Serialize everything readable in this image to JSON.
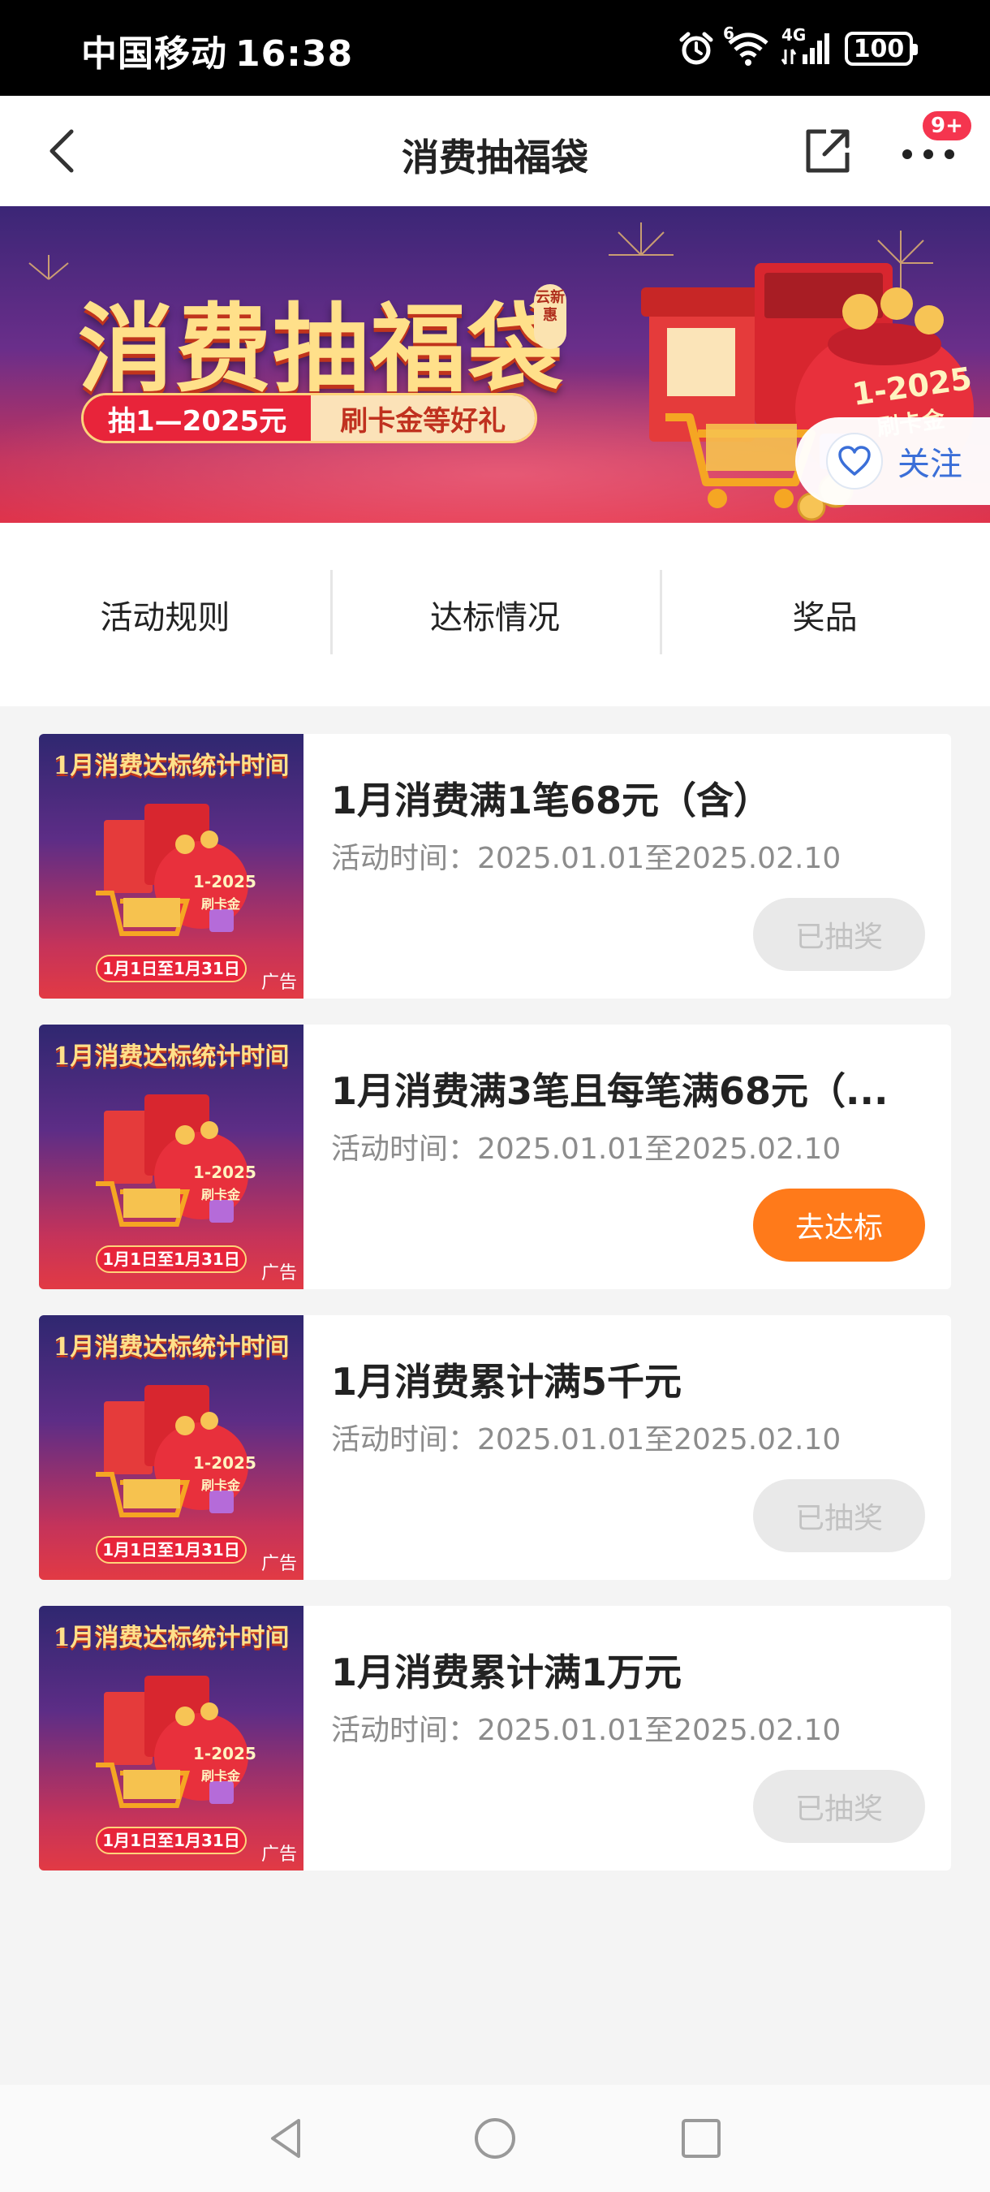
{
  "status_bar": {
    "carrier": "中国移动",
    "time": "16:38",
    "signal_label": "4G",
    "wifi_label": "6",
    "battery": "100"
  },
  "nav": {
    "title": "消费抽福袋",
    "badge": "9+"
  },
  "banner": {
    "title": "消费抽福袋",
    "tag": "云新惠",
    "subtitle_prize": "抽1—2025元",
    "subtitle_gift": "刷卡金等好礼",
    "art_text": "1-2025",
    "art_sub": "刷卡金",
    "follow_label": "关注"
  },
  "tabs": [
    {
      "label": "活动规则"
    },
    {
      "label": "达标情况"
    },
    {
      "label": "奖品"
    }
  ],
  "thumb": {
    "headline": "1月消费达标统计时间",
    "date_range": "1月1日至1月31日",
    "ad_label": "广告",
    "art_text": "1-2025",
    "art_sub": "刷卡金"
  },
  "cards": [
    {
      "title": "1月消费满1笔68元（含）",
      "time": "活动时间：2025.01.01至2025.02.10",
      "button": "已抽奖",
      "state": "done"
    },
    {
      "title": "1月消费满3笔且每笔满68元（...",
      "time": "活动时间：2025.01.01至2025.02.10",
      "button": "去达标",
      "state": "go"
    },
    {
      "title": "1月消费累计满5千元",
      "time": "活动时间：2025.01.01至2025.02.10",
      "button": "已抽奖",
      "state": "done"
    },
    {
      "title": "1月消费累计满1万元",
      "time": "活动时间：2025.01.01至2025.02.10",
      "button": "已抽奖",
      "state": "done"
    }
  ],
  "colors": {
    "accent_orange": "#ff7a1a",
    "follow_blue": "#3b6fd8",
    "badge_red": "#f5354f",
    "done_gray": "#e9e9e9"
  },
  "icons": {
    "back": "chevron-left-icon",
    "share": "share-icon",
    "more": "more-dots-icon",
    "follow": "heart-icon",
    "sys_back": "triangle-back-icon",
    "sys_home": "circle-home-icon",
    "sys_recent": "square-recent-icon"
  }
}
